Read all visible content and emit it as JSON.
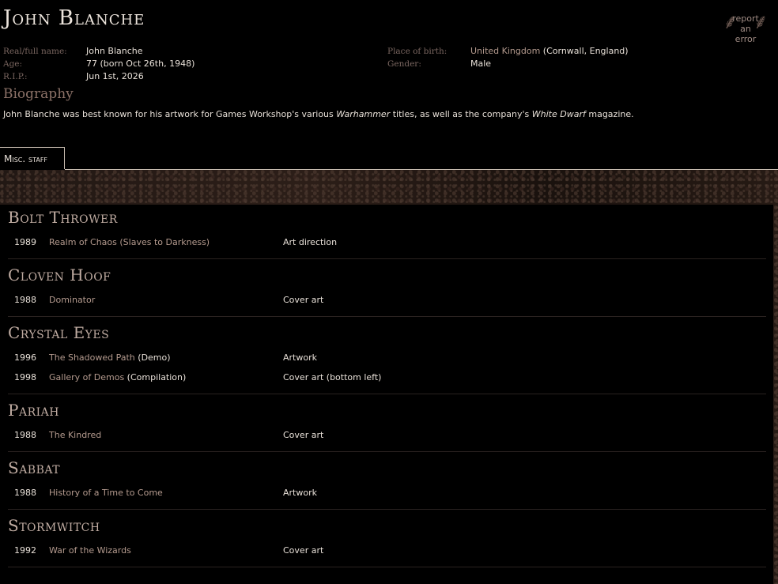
{
  "page_title": "John Blanche",
  "report": {
    "line1": "report",
    "line2": "an error"
  },
  "info_left": [
    {
      "label": "Real/full name:",
      "value": "John Blanche"
    },
    {
      "label": "Age:",
      "value": "77 (born Oct 26th, 1948)"
    },
    {
      "label": "R.I.P.:",
      "value": "Jun 1st, 2026"
    }
  ],
  "info_right": [
    {
      "label": "Place of birth:",
      "value_link": "United Kingdom",
      "value_extra": " (Cornwall, England)"
    },
    {
      "label": "Gender:",
      "value": "Male"
    }
  ],
  "biography": {
    "heading": "Biography",
    "p1": "John Blanche was best known for his artwork for Games Workshop's various ",
    "em1": "Warhammer",
    "p2": " titles, as well as the company's ",
    "em2": "White Dwarf",
    "p3": " magazine."
  },
  "tab": {
    "label": "Misc. staff"
  },
  "bands": [
    {
      "name": "Bolt Thrower",
      "entries": [
        {
          "year": "1989",
          "release": "Realm of Chaos (Slaves to Darkness)",
          "suffix": "",
          "role": "Art direction"
        }
      ]
    },
    {
      "name": "Cloven Hoof",
      "entries": [
        {
          "year": "1988",
          "release": "Dominator",
          "suffix": "",
          "role": "Cover art"
        }
      ]
    },
    {
      "name": "Crystal Eyes",
      "entries": [
        {
          "year": "1996",
          "release": "The Shadowed Path",
          "suffix": " (Demo)",
          "role": "Artwork"
        },
        {
          "year": "1998",
          "release": "Gallery of Demos",
          "suffix": " (Compilation)",
          "role": "Cover art (bottom left)"
        }
      ]
    },
    {
      "name": "Pariah",
      "entries": [
        {
          "year": "1988",
          "release": "The Kindred",
          "suffix": "",
          "role": "Cover art"
        }
      ]
    },
    {
      "name": "Sabbat",
      "entries": [
        {
          "year": "1988",
          "release": "History of a Time to Come",
          "suffix": "",
          "role": "Artwork"
        }
      ]
    },
    {
      "name": "Stormwitch",
      "entries": [
        {
          "year": "1992",
          "release": "War of the Wizards",
          "suffix": "",
          "role": "Cover art"
        }
      ]
    }
  ]
}
